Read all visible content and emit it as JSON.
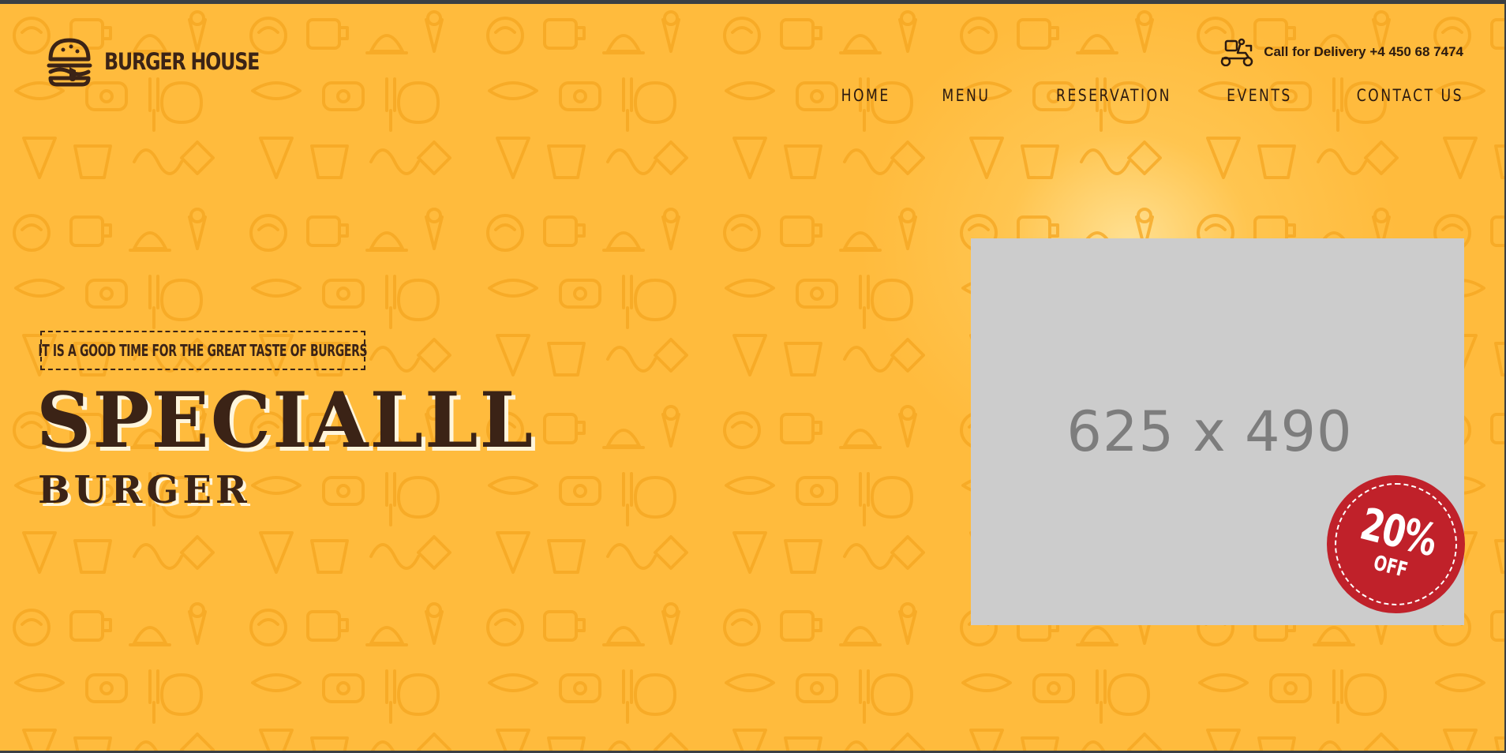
{
  "brand": {
    "name": "BURGER HOUSE",
    "logo_icon": "burger-icon"
  },
  "header": {
    "delivery_icon": "delivery-scooter-icon",
    "delivery_text": "Call for Delivery +4 450 68 7474"
  },
  "nav": {
    "items": [
      {
        "label": "HOME"
      },
      {
        "label": "MENU"
      },
      {
        "label": "RESERVATION"
      },
      {
        "label": "EVENTS"
      },
      {
        "label": "CONTACT US"
      }
    ]
  },
  "hero": {
    "tagline": "IT IS A GOOD TIME FOR THE GREAT TASTE OF BURGERS",
    "headline": "SPECIALLL",
    "subheadline": "BURGER",
    "image_placeholder": "625 x 490",
    "badge": {
      "percent": "20%",
      "off": "OFF"
    }
  },
  "colors": {
    "background": "#ffbb3d",
    "text_dark": "#3b2316",
    "badge_red": "#c0212a",
    "placeholder_gray": "#cccccc"
  }
}
